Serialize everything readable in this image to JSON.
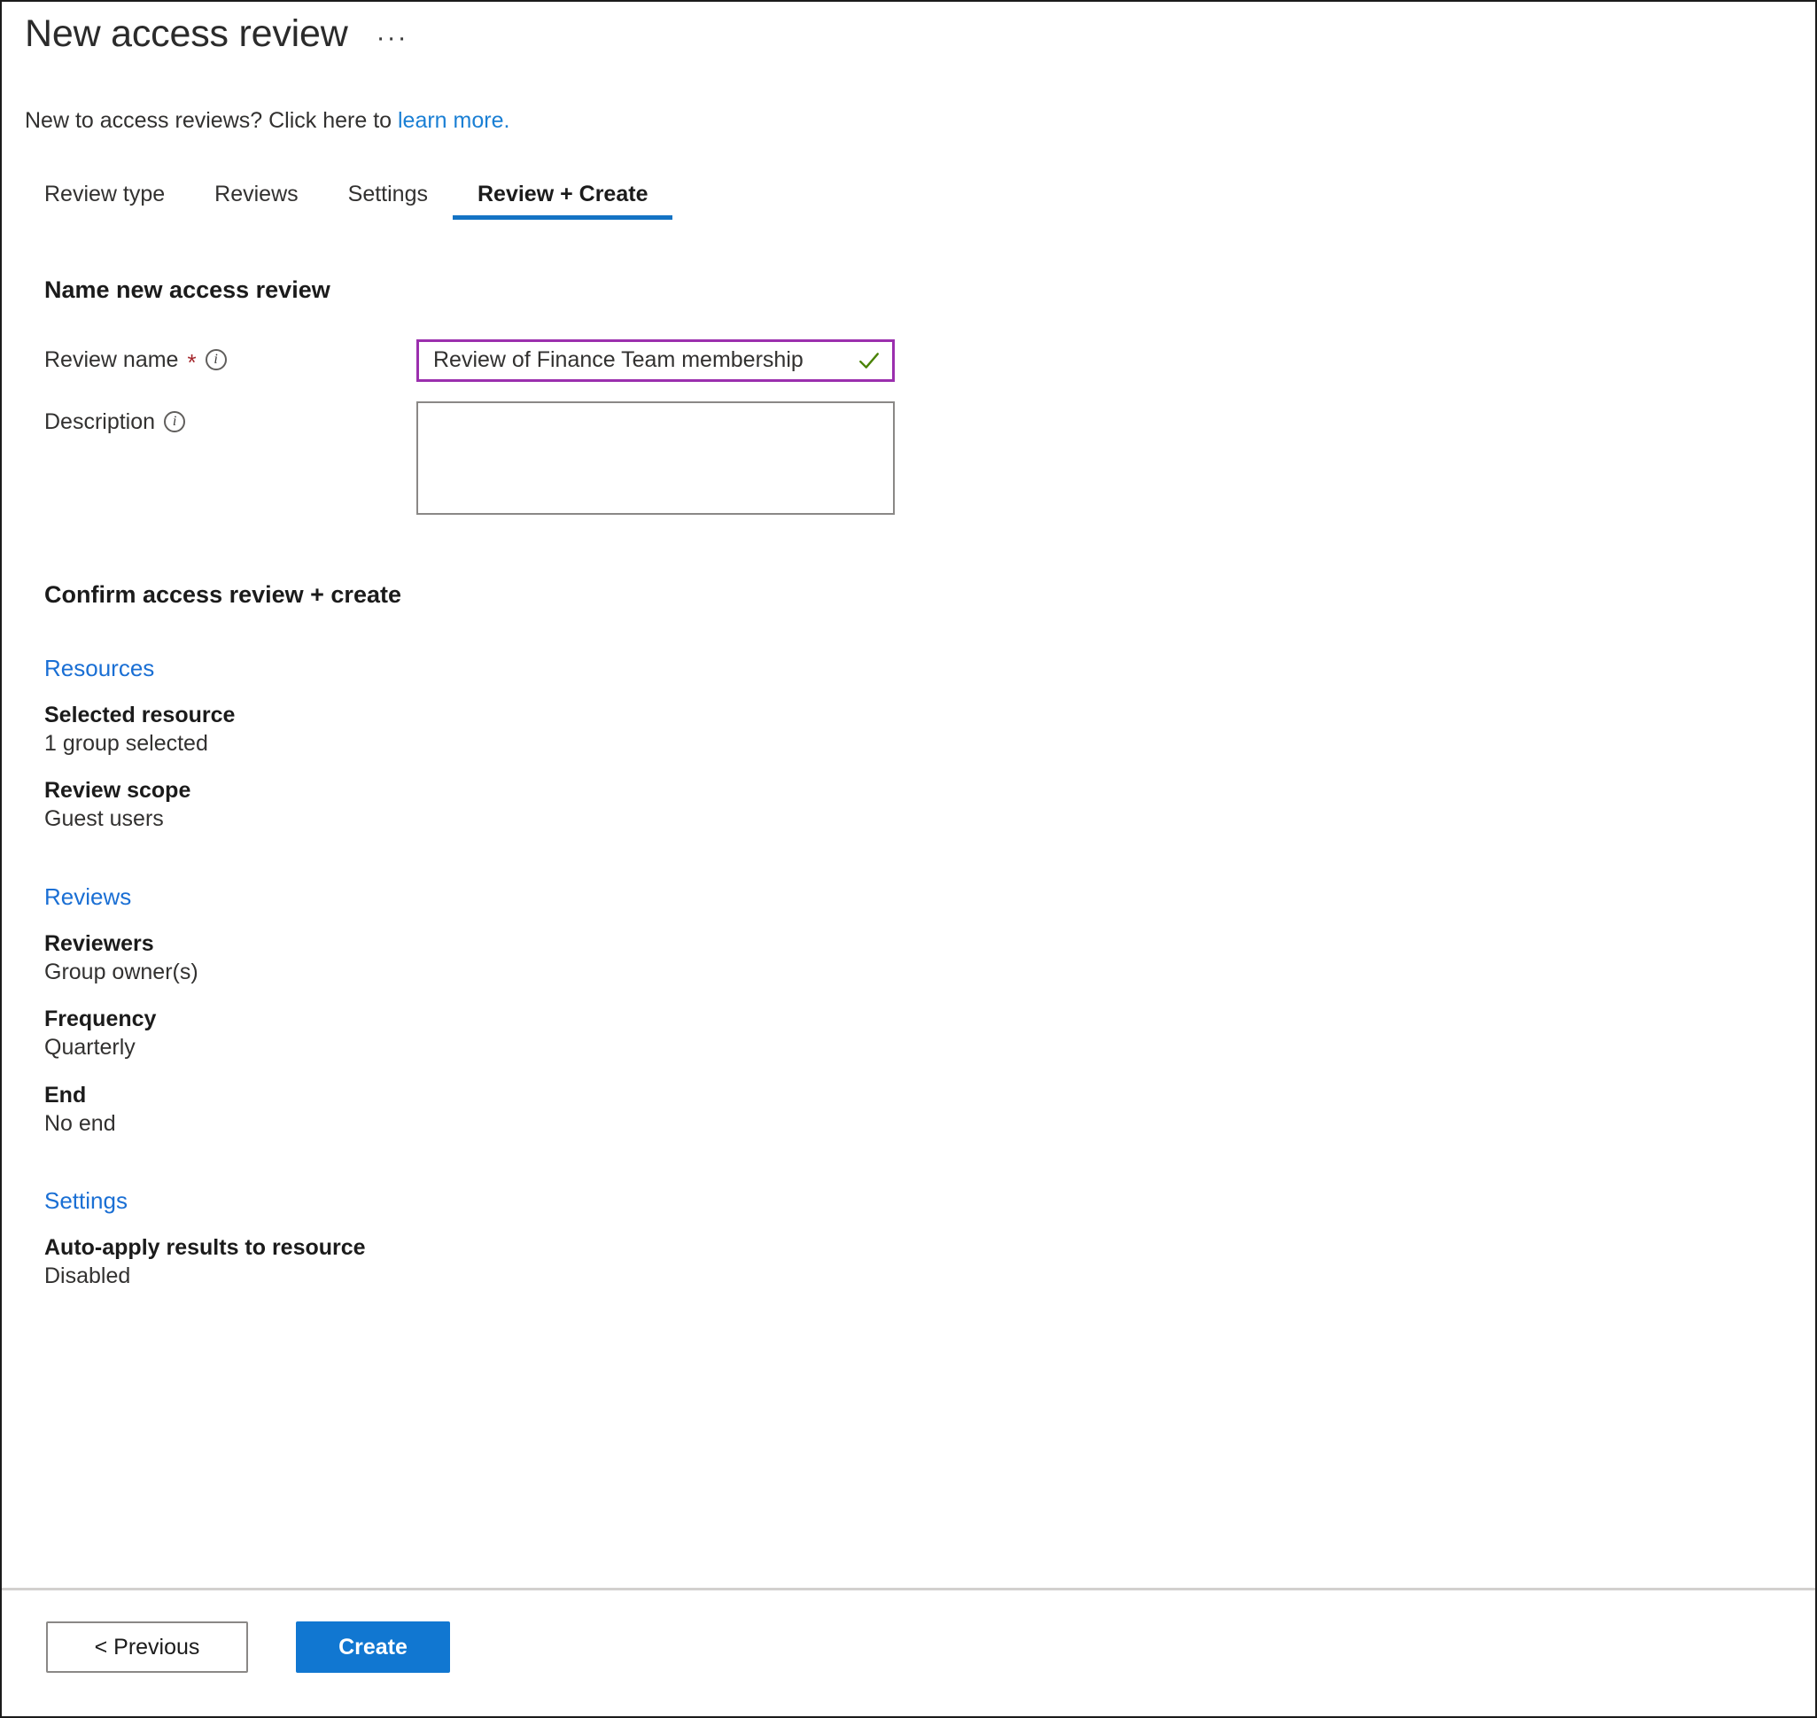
{
  "header": {
    "title": "New access review",
    "more_label": "···",
    "subtitle_text": "New to access reviews? Click here to ",
    "subtitle_link": "learn more."
  },
  "tabs": [
    {
      "label": "Review type",
      "active": false
    },
    {
      "label": "Reviews",
      "active": false
    },
    {
      "label": "Settings",
      "active": false
    },
    {
      "label": "Review + Create",
      "active": true
    }
  ],
  "name_section": {
    "heading": "Name new access review",
    "review_name": {
      "label": "Review name",
      "required_marker": "*",
      "info_icon": "info-icon",
      "value": "Review of Finance Team membership",
      "placeholder": "",
      "validation_icon": "check-icon"
    },
    "description": {
      "label": "Description",
      "info_icon": "info-icon",
      "value": "",
      "placeholder": ""
    }
  },
  "confirm_section": {
    "heading": "Confirm access review + create",
    "groups": [
      {
        "link": "Resources",
        "items": [
          {
            "label": "Selected resource",
            "value": "1 group selected"
          },
          {
            "label": "Review scope",
            "value": "Guest users"
          }
        ]
      },
      {
        "link": "Reviews",
        "items": [
          {
            "label": "Reviewers",
            "value": "Group owner(s)"
          },
          {
            "label": "Frequency",
            "value": "Quarterly"
          },
          {
            "label": "End",
            "value": "No end"
          }
        ]
      },
      {
        "link": "Settings",
        "items": [
          {
            "label": "Auto-apply results to resource",
            "value": "Disabled"
          }
        ]
      }
    ]
  },
  "footer": {
    "previous_label": "< Previous",
    "create_label": "Create"
  },
  "colors": {
    "accent_blue": "#1177d1",
    "link_blue": "#1a7fd4",
    "group_link_blue": "#1a6fd4",
    "input_focus_border": "#9b2fae",
    "required_red": "#a4262c",
    "valid_green": "#498205",
    "tab_underline": "#1473c4",
    "divider": "#d2d0ce"
  }
}
